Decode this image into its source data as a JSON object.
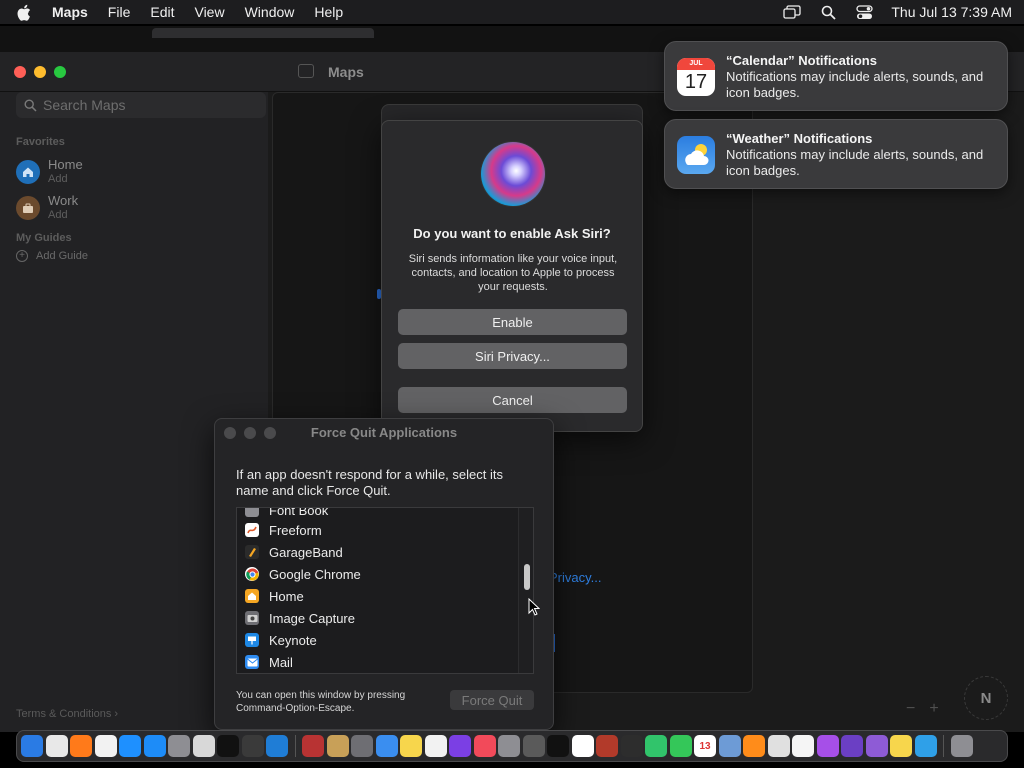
{
  "menubar": {
    "app_name": "Maps",
    "items": [
      "File",
      "Edit",
      "View",
      "Window",
      "Help"
    ],
    "clock": "Thu Jul 13  7:39 AM"
  },
  "maps": {
    "title": "Maps",
    "search_placeholder": "Search Maps",
    "favorites_header": "Favorites",
    "favorites": [
      {
        "name": "Home",
        "sub": "Add"
      },
      {
        "name": "Work",
        "sub": "Add"
      }
    ],
    "guides_header": "My Guides",
    "add_guide": "Add Guide",
    "terms": "Terms & Conditions",
    "privacy_link": "Privacy...",
    "compass": "N",
    "zoom_out": "−",
    "zoom_in": "+"
  },
  "siri": {
    "title": "Do you want to enable Ask Siri?",
    "body": "Siri sends information like your voice input, contacts, and location to Apple to process your requests.",
    "enable": "Enable",
    "privacy": "Siri Privacy...",
    "cancel": "Cancel"
  },
  "force_quit": {
    "title": "Force Quit Applications",
    "instructions": "If an app doesn't respond for a while, select its name and click Force Quit.",
    "apps": [
      {
        "name": "Font Book",
        "color": "#8e8e93"
      },
      {
        "name": "Freeform",
        "color": "#ffffff"
      },
      {
        "name": "GarageBand",
        "color": "#2b2b2b"
      },
      {
        "name": "Google Chrome",
        "color": "#ffffff"
      },
      {
        "name": "Home",
        "color": "#f5a623"
      },
      {
        "name": "Image Capture",
        "color": "#6e6e73"
      },
      {
        "name": "Keynote",
        "color": "#1e88e5"
      },
      {
        "name": "Mail",
        "color": "#2e8bf0"
      }
    ],
    "footer": "You can open this window by pressing Command-Option-Escape.",
    "button": "Force Quit"
  },
  "notifications": [
    {
      "title": "“Calendar” Notifications",
      "body": "Notifications may include alerts, sounds, and icon badges.",
      "icon": "calendar-icon",
      "month": "JUL",
      "day": "17"
    },
    {
      "title": "“Weather” Notifications",
      "body": "Notifications may include alerts, sounds, and icon badges.",
      "icon": "weather-icon"
    }
  ],
  "dock": {
    "calendar_day": "13",
    "apps": [
      {
        "name": "finder-icon",
        "color": "#2a7be4"
      },
      {
        "name": "launchpad-icon",
        "color": "#e8e8e8"
      },
      {
        "name": "firefox-icon",
        "color": "#ff7a1a"
      },
      {
        "name": "chrome-icon",
        "color": "#f2f2f2"
      },
      {
        "name": "safari-icon",
        "color": "#1e90ff"
      },
      {
        "name": "app-store-icon",
        "color": "#1d8cf8"
      },
      {
        "name": "system-settings-icon",
        "color": "#8e8e93"
      },
      {
        "name": "script-editor-icon",
        "color": "#d8d8d8"
      },
      {
        "name": "terminal-icon",
        "color": "#111111"
      },
      {
        "name": "brush-icon",
        "color": "#3a3a3a"
      },
      {
        "name": "vscode-icon",
        "color": "#1f7dd6"
      },
      {
        "name": "separator"
      },
      {
        "name": "instruments-icon",
        "color": "#b83333"
      },
      {
        "name": "archive-icon",
        "color": "#c8a058"
      },
      {
        "name": "image-capture-icon",
        "color": "#6e6e73"
      },
      {
        "name": "icloud-icon",
        "color": "#3a8ef0"
      },
      {
        "name": "notes-icon",
        "color": "#f7d64c"
      },
      {
        "name": "reminders-icon",
        "color": "#f2f2f2"
      },
      {
        "name": "shortcuts-icon",
        "color": "#7b3fe4"
      },
      {
        "name": "news-icon",
        "color": "#f24a5a"
      },
      {
        "name": "font-book-icon",
        "color": "#8e8e93"
      },
      {
        "name": "chess-icon",
        "color": "#5a5a5a"
      },
      {
        "name": "tv-icon",
        "color": "#111111"
      },
      {
        "name": "freeform-icon",
        "color": "#ffffff"
      },
      {
        "name": "dictionary-icon",
        "color": "#b23a2a"
      },
      {
        "name": "activity-monitor-icon",
        "color": "#2d2d2d"
      },
      {
        "name": "find-my-icon",
        "color": "#31c46b"
      },
      {
        "name": "messages-icon",
        "color": "#34c759"
      },
      {
        "name": "calendar-icon",
        "color": "#ffffff"
      },
      {
        "name": "preview-icon",
        "color": "#6d9bd6"
      },
      {
        "name": "books-icon",
        "color": "#ff8c1a"
      },
      {
        "name": "calculator-icon",
        "color": "#e0e0e0"
      },
      {
        "name": "clock-icon",
        "color": "#f5f5f5"
      },
      {
        "name": "podcasts-icon",
        "color": "#a64fe8"
      },
      {
        "name": "visual-studio-icon",
        "color": "#6b3fc4"
      },
      {
        "name": "screen-sharing-icon",
        "color": "#8e5bd6"
      },
      {
        "name": "notes-yellow-icon",
        "color": "#f7d64c"
      },
      {
        "name": "preview-photos-icon",
        "color": "#2fa0e8"
      },
      {
        "name": "separator"
      },
      {
        "name": "trash-icon",
        "color": "#8e8e93"
      }
    ]
  }
}
